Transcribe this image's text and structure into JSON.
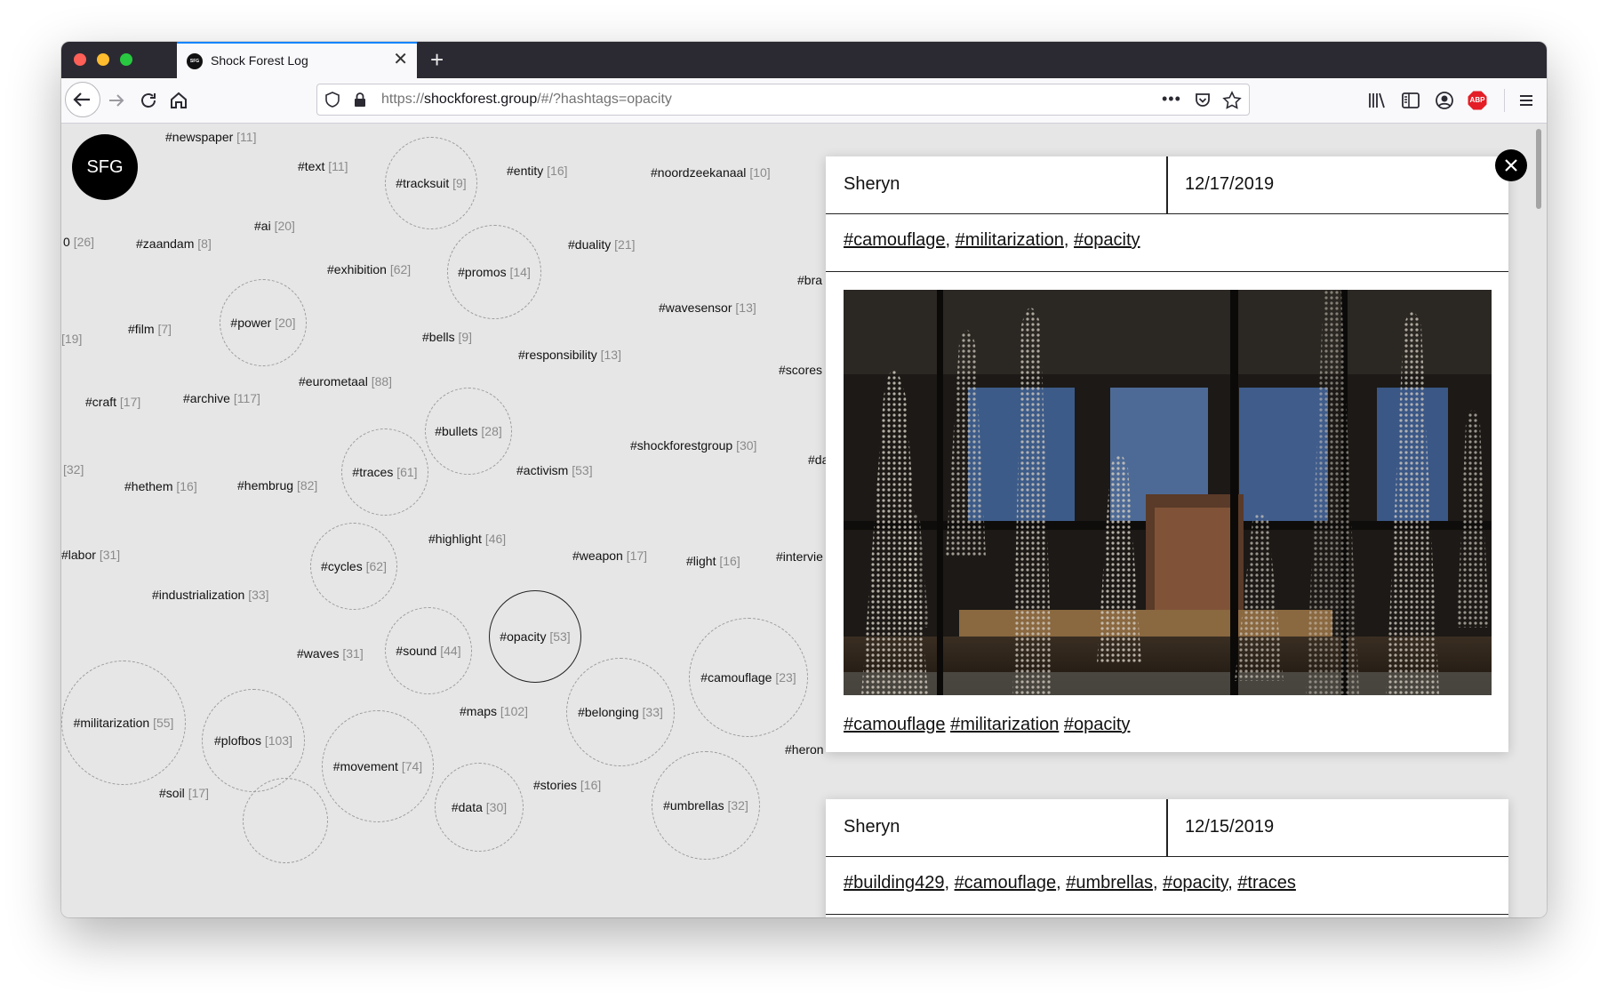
{
  "browser": {
    "tab_title": "Shock Forest Log",
    "tab_favicon_text": "SFG",
    "url_scheme": "https://",
    "url_host": "shockforest.group",
    "url_path": "/#/?hashtags=opacity",
    "icons": [
      "back-icon",
      "forward-icon",
      "reload-icon",
      "home-icon",
      "shield-icon",
      "lock-icon",
      "more-icon",
      "pocket-icon",
      "bookmark-star-icon",
      "library-icon",
      "sidebar-icon",
      "account-icon",
      "adblock-icon",
      "menu-icon"
    ],
    "adblock_label": "ABP"
  },
  "logo": "SFG",
  "tags": [
    {
      "name": "#newspaper",
      "count": "[11]"
    },
    {
      "name": "#text",
      "count": "[11]"
    },
    {
      "name": "#tracksuit",
      "count": "[9]"
    },
    {
      "name": "#entity",
      "count": "[16]"
    },
    {
      "name": "#noordzeekanaal",
      "count": "[10]"
    },
    {
      "name": "#ai",
      "count": "[20]"
    },
    {
      "name": "0",
      "count": "[26]"
    },
    {
      "name": "#zaandam",
      "count": "[8]"
    },
    {
      "name": "#promos",
      "count": "[14]"
    },
    {
      "name": "#duality",
      "count": "[21]"
    },
    {
      "name": "#exhibition",
      "count": "[62]"
    },
    {
      "name": "#bra",
      "count": ""
    },
    {
      "name": "#power",
      "count": "[20]"
    },
    {
      "name": "#wavesensor",
      "count": "[13]"
    },
    {
      "name": "",
      "count": "[19]"
    },
    {
      "name": "#film",
      "count": "[7]"
    },
    {
      "name": "#bells",
      "count": "[9]"
    },
    {
      "name": "#responsibility",
      "count": "[13]"
    },
    {
      "name": "#scores",
      "count": ""
    },
    {
      "name": "#eurometaal",
      "count": "[88]"
    },
    {
      "name": "#craft",
      "count": "[17]"
    },
    {
      "name": "#archive",
      "count": "[117]"
    },
    {
      "name": "#bullets",
      "count": "[28]"
    },
    {
      "name": "#shockforestgroup",
      "count": "[30]"
    },
    {
      "name": "#da",
      "count": ""
    },
    {
      "name": "",
      "count": "[32]"
    },
    {
      "name": "#hethem",
      "count": "[16]"
    },
    {
      "name": "#hembrug",
      "count": "[82]"
    },
    {
      "name": "#traces",
      "count": "[61]"
    },
    {
      "name": "#activism",
      "count": "[53]"
    },
    {
      "name": "#highlight",
      "count": "[46]"
    },
    {
      "name": "#labor",
      "count": "[31]"
    },
    {
      "name": "#cycles",
      "count": "[62]"
    },
    {
      "name": "#weapon",
      "count": "[17]"
    },
    {
      "name": "#light",
      "count": "[16]"
    },
    {
      "name": "#intervie",
      "count": ""
    },
    {
      "name": "#industrialization",
      "count": "[33]"
    },
    {
      "name": "#opacity",
      "count": "[53]"
    },
    {
      "name": "#sound",
      "count": "[44]"
    },
    {
      "name": "#waves",
      "count": "[31]"
    },
    {
      "name": "#camouflage",
      "count": "[23]"
    },
    {
      "name": "#militarization",
      "count": "[55]"
    },
    {
      "name": "#belonging",
      "count": "[33]"
    },
    {
      "name": "#plofbos",
      "count": "[103]"
    },
    {
      "name": "#maps",
      "count": "[102]"
    },
    {
      "name": "#movement",
      "count": "[74]"
    },
    {
      "name": "#heron",
      "count": ""
    },
    {
      "name": "#umbrellas",
      "count": "[32]"
    },
    {
      "name": "#soil",
      "count": "[17]"
    },
    {
      "name": "#stories",
      "count": "[16]"
    },
    {
      "name": "#data",
      "count": "[30]"
    }
  ],
  "posts": [
    {
      "author": "Sheryn",
      "date": "12/17/2019",
      "tags": [
        "#camouflage",
        "#militarization",
        "#opacity"
      ],
      "footer_tags": [
        "#camouflage",
        "#militarization",
        "#opacity"
      ]
    },
    {
      "author": "Sheryn",
      "date": "12/15/2019",
      "tags": [
        "#building429",
        "#camouflage",
        "#umbrellas",
        "#opacity",
        "#traces"
      ]
    }
  ]
}
